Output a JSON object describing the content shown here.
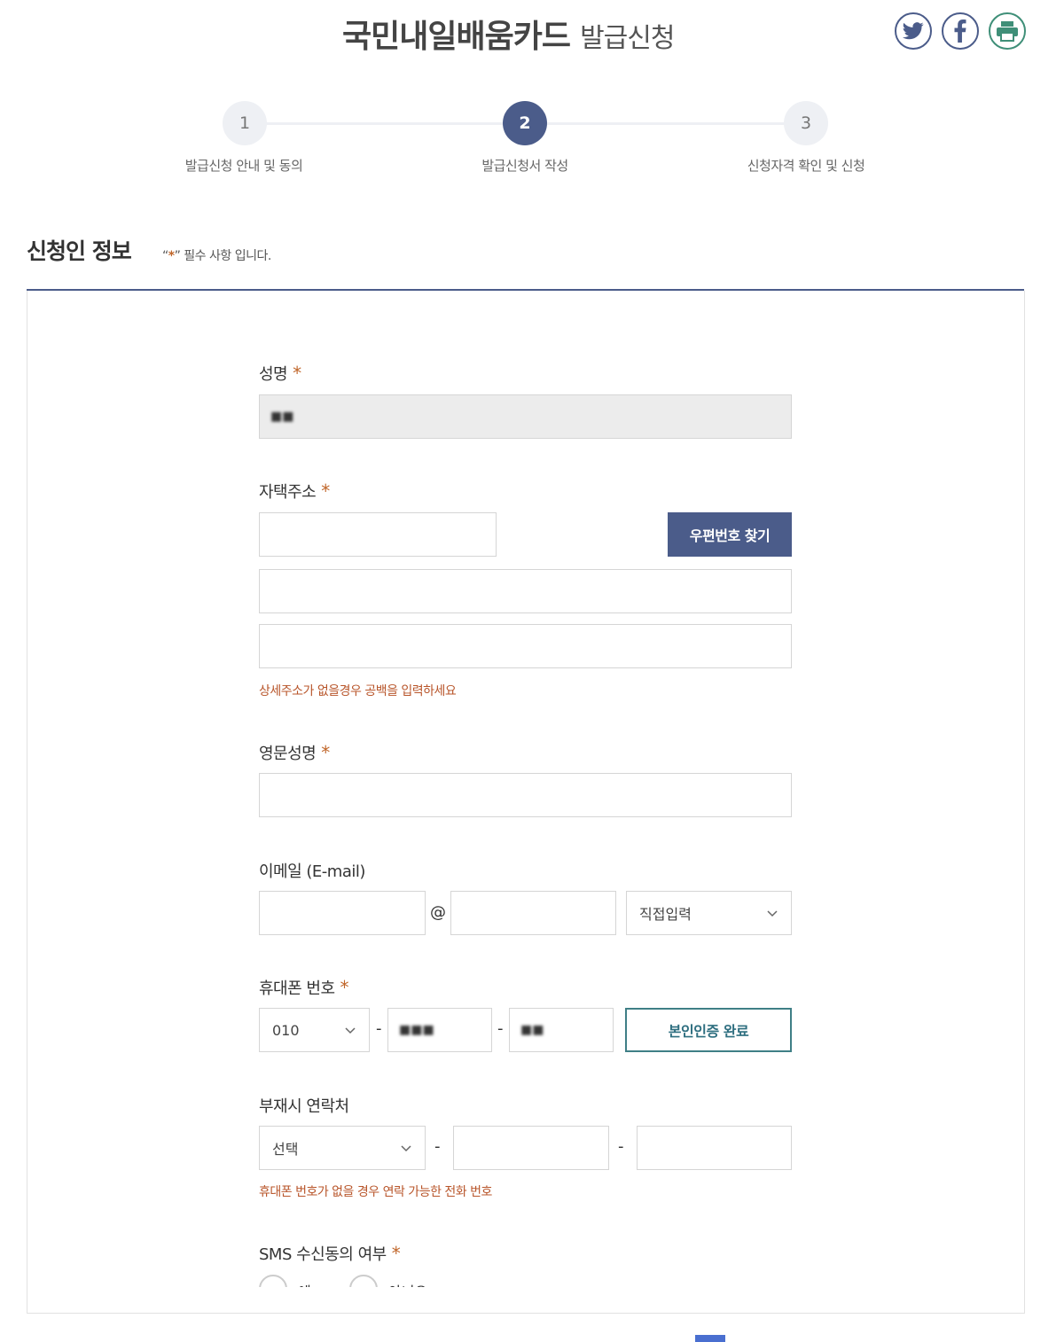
{
  "header": {
    "title_main": "국민내일배움카드",
    "title_sub": "발급신청",
    "share_icons": [
      "twitter-icon",
      "facebook-icon",
      "print-icon"
    ],
    "accent_color": "#4b5c8a"
  },
  "steps": [
    {
      "number": "1",
      "label": "발급신청 안내 및 동의",
      "active": false
    },
    {
      "number": "2",
      "label": "발급신청서 작성",
      "active": true
    },
    {
      "number": "3",
      "label": "신청자격 확인 및 신청",
      "active": false
    }
  ],
  "section": {
    "title": "신청인 정보",
    "note_open": "“",
    "note_star": "*",
    "note_rest": "” 필수 사항 입니다."
  },
  "form": {
    "required_mark": "*",
    "name": {
      "label": "성명",
      "value": "■■"
    },
    "address": {
      "label": "자택주소",
      "zip_button": "우편번호 찾기",
      "hint": "상세주소가 없을경우 공백을 입력하세요"
    },
    "english_name": {
      "label": "영문성명"
    },
    "email": {
      "label": "이메일 (E-mail)",
      "at": "@",
      "domain_select": "직접입력"
    },
    "mobile": {
      "label": "휴대폰 번호",
      "prefix": "010",
      "middle": "■■■",
      "last": "■■",
      "dash": "-",
      "verify_button": "본인인증 완료"
    },
    "alt_contact": {
      "label": "부재시 연락처",
      "select": "선택",
      "dash": "-",
      "hint": "휴대폰 번호가 없을 경우 연락 가능한 전화 번호"
    },
    "sms": {
      "label": "SMS 수신동의 여부",
      "options": [
        "예",
        "아니오"
      ]
    }
  }
}
